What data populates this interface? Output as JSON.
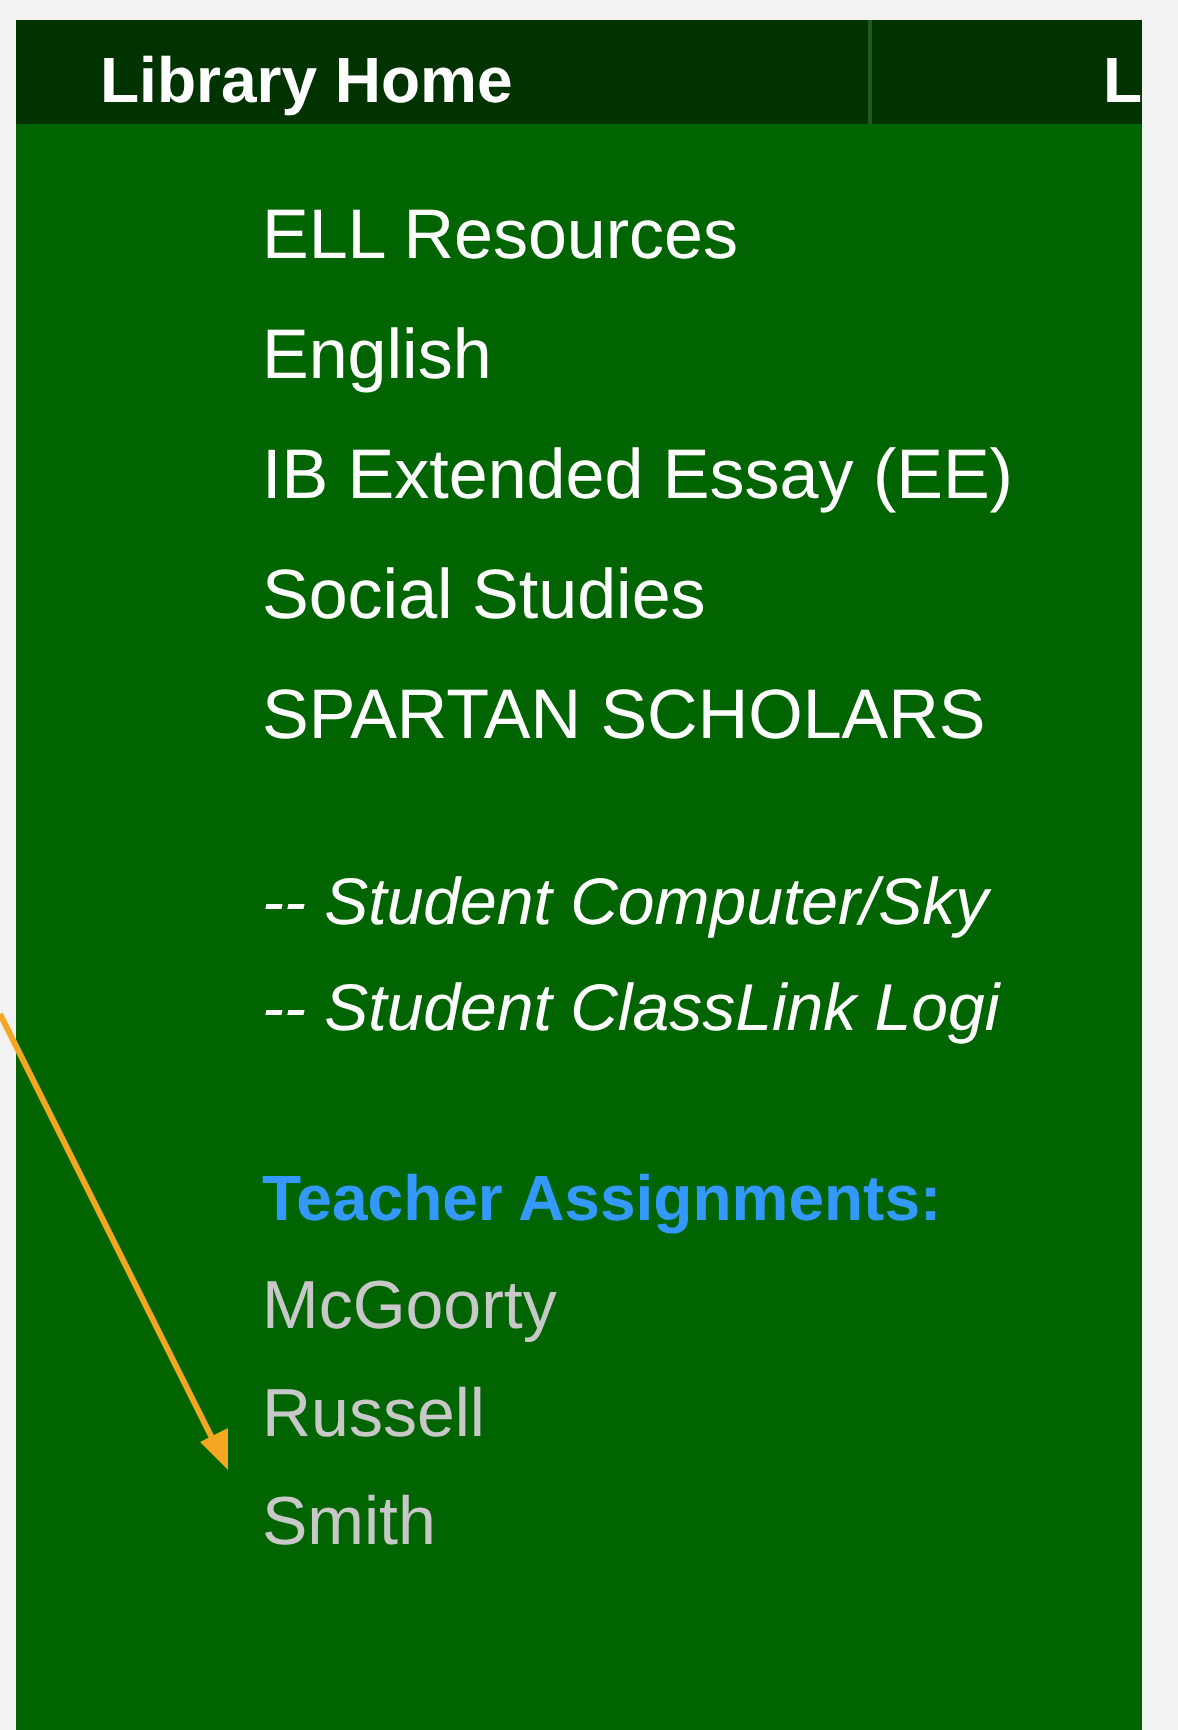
{
  "nav_tabs": [
    {
      "label": "Library Home"
    },
    {
      "label": "L"
    }
  ],
  "subject_links": [
    "ELL Resources",
    "English",
    "IB Extended Essay (EE)",
    "Social Studies",
    "SPARTAN SCHOLARS"
  ],
  "login_links": [
    "-- Student Computer/Sky",
    "-- Student ClassLink Logi"
  ],
  "teacher_assignments": {
    "heading": "Teacher Assignments:",
    "names": [
      "McGoorty",
      "Russell",
      "Smith"
    ]
  }
}
